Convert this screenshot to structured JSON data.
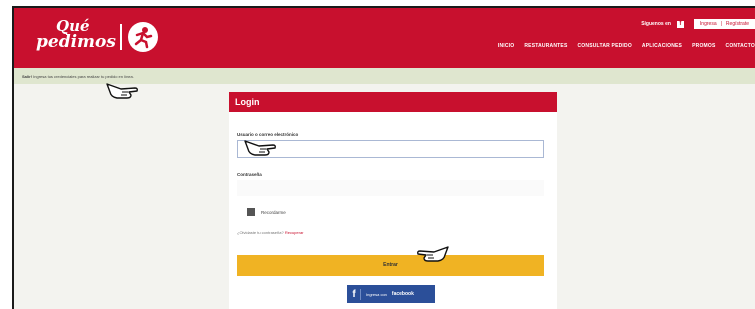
{
  "header": {
    "logo_top": "Qué",
    "logo_bottom": "pedimos",
    "follow_label": "Síguenos en",
    "fb_glyph": "f",
    "login_link": "Ingresa",
    "divider": "|",
    "register_link": "Regístrate",
    "nav": [
      "INICIO",
      "RESTAURANTES",
      "CONSULTAR PEDIDO",
      "APLICACIONES",
      "PROMOS",
      "CONTACTO"
    ],
    "brand_color": "#c8102e"
  },
  "notice": {
    "strong": "Salir!",
    "text": "Ingresa tus credenciales para realizar tu pedido en línea."
  },
  "login": {
    "title": "Login",
    "user_label": "Usuario o correo electrónico",
    "password_label": "Contraseña",
    "remember_label": "Recordarme",
    "forgot_text": "¿Olvidaste tu contraseña?",
    "forgot_link": "Recuperar",
    "submit_label": "Entrar",
    "fb_glyph": "f",
    "fb_prefix": "Ingresa con",
    "fb_word": "facebook",
    "accent": "#f0b323"
  },
  "cursors": [
    "pointing-hand-icon",
    "pointing-hand-icon",
    "pointing-hand-icon"
  ]
}
